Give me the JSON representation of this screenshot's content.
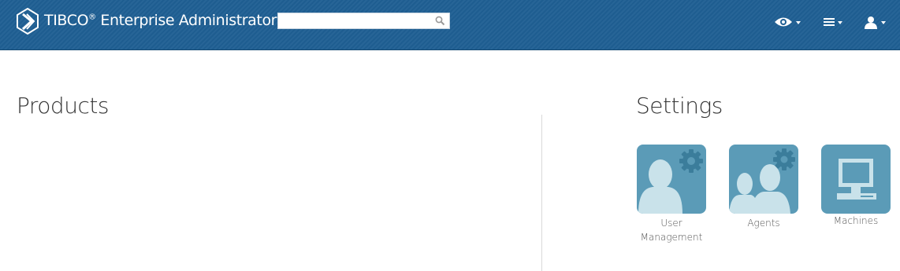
{
  "header": {
    "app_title": "TIBCO",
    "app_title_reg": "®",
    "app_title_rest": " Enterprise Administrator",
    "search": {
      "value": "",
      "placeholder": ""
    }
  },
  "main": {
    "products_title": "Products",
    "settings_title": "Settings",
    "settings_items": [
      {
        "label_line1": "User",
        "label_line2": "Management",
        "icon": "user-management-icon"
      },
      {
        "label_line1": "Agents",
        "label_line2": "",
        "icon": "agents-icon"
      },
      {
        "label_line1": "Machines",
        "label_line2": "",
        "icon": "machines-icon"
      }
    ]
  },
  "colors": {
    "header_bg": "#1f5f93",
    "tile_bg": "#5b9bb7",
    "tile_fg": "#c9e2ea"
  }
}
